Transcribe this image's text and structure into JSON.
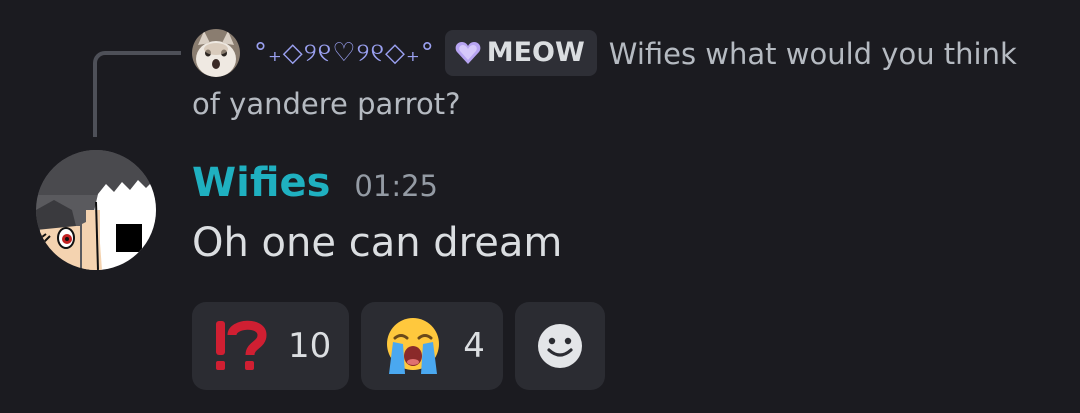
{
  "reply": {
    "author": "°₊◇୨୧♡୨୧◇₊°",
    "clan_tag": "MEOW",
    "text": "Wifies what would you think of yandere parrot?"
  },
  "message": {
    "author": "Wifies",
    "timestamp": "01:25",
    "text": "Oh one can dream"
  },
  "reactions": [
    {
      "emoji": "interrobang-icon",
      "count": "10"
    },
    {
      "emoji": "loudly-crying-face-icon",
      "count": "4"
    }
  ],
  "add_reaction_icon": "smiley-add-reaction-icon",
  "colors": {
    "background": "#1b1b20",
    "author": "#1fb0c0",
    "reaction_bg": "#2b2c32",
    "interrobang": "#d01f32"
  }
}
